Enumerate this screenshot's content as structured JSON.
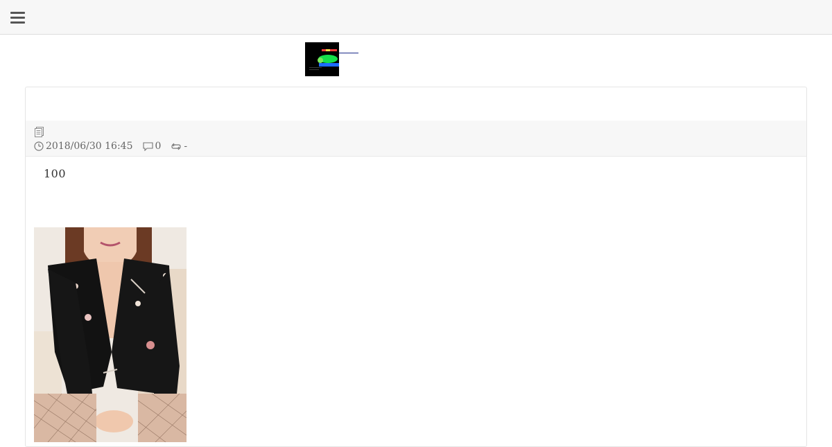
{
  "header": {
    "menu_icon": "hamburger-menu-icon"
  },
  "post": {
    "meta": {
      "category_icon": "document-icon",
      "date_icon": "clock-icon",
      "date": "2018/06/30 16:45",
      "comment_icon": "comment-icon",
      "comments": "0",
      "trackback_icon": "trackback-icon",
      "trackbacks": "-"
    },
    "body_text": "100",
    "photo_icon": "photo-image"
  }
}
